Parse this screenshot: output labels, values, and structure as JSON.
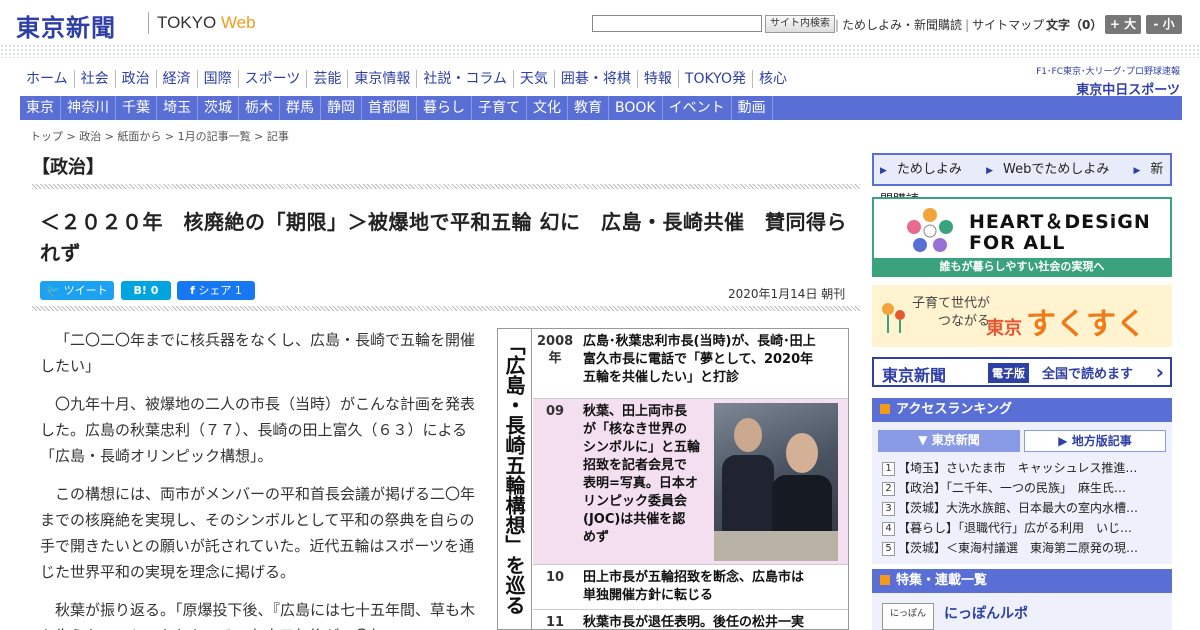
{
  "header": {
    "logo": "東京新聞",
    "logo_sub_prefix": "TOKYO ",
    "logo_sub_accent": "Web",
    "search_button": "サイト内検索",
    "links": [
      "ためしよみ・新聞購読",
      "サイトマップ"
    ],
    "font_label": "文字（0）",
    "font_bigger": "+ 大",
    "font_smaller": "- 小"
  },
  "main_nav": [
    "ホーム",
    "社会",
    "政治",
    "経済",
    "国際",
    "スポーツ",
    "芸能",
    "東京情報",
    "社説・コラム",
    "天気",
    "囲碁・将棋",
    "特報",
    "TOKYO発",
    "核心"
  ],
  "chunichi": {
    "small": "F1･FC東京･大リーグ･プロ野球速報",
    "big": "東京中日スポーツ"
  },
  "sub_nav": [
    "東京",
    "神奈川",
    "千葉",
    "埼玉",
    "茨城",
    "栃木",
    "群馬",
    "静岡",
    "首都圏",
    "暮らし",
    "子育て",
    "文化",
    "教育",
    "BOOK",
    "イベント",
    "動画"
  ],
  "breadcrumb": [
    "トップ",
    "政治",
    "紙面から",
    "1月の記事一覧",
    "記事"
  ],
  "section": "【政治】",
  "article": {
    "headline": "＜２０２０年　核廃絶の「期限」＞被爆地で平和五輪 幻に　広島・長崎共催　賛同得られず",
    "share": {
      "tweet": "ツイート",
      "hatena": "B! 0",
      "facebook": "シェア 1"
    },
    "date": "2020年1月14日 朝刊",
    "paragraphs": [
      "「二〇二〇年までに核兵器をなくし、広島・長崎で五輪を開催したい」",
      "〇九年十月、被爆地の二人の市長（当時）がこんな計画を発表した。広島の秋葉忠利（７７）、長崎の田上富久（６３）による「広島・長崎オリンピック構想」。",
      "この構想には、両市がメンバーの平和首長会議が掲げる二〇年までの核廃絶を実現し、そのシンボルとして平和の祭典を自らの手で開きたいとの願いが託されていた。近代五輪はスポーツを通じた世界平和の実現を理念に掲げる。",
      "秋葉が振り返る。「原爆投下後、『広島には七十五年間、草も木も生えない』といわれた。その七十五年後が二〇年"
    ]
  },
  "timeline": {
    "title": "「広島・長崎五輪構想」を巡る動き",
    "rows": [
      {
        "year": "2008\n年",
        "text": "広島･秋葉忠利市長(当時)が、長崎･田上\n富久市長に電話で「夢として、2020年\n五輪を共催したい」と打診"
      },
      {
        "year": "09",
        "text": "秋葉、田上両市長\nが「核なき世界の\nシンボルに」と五輪\n招致を記者会見で\n表明=写真。日本オ\nリンピック委員会\n(JOC)は共催を認\nめず"
      },
      {
        "year": "10",
        "text": "田上市長が五輪招致を断念、広島市は\n単独開催方針に転じる"
      },
      {
        "year": "11",
        "text": "秋葉市長が退任表明。後任の松井一実"
      }
    ]
  },
  "sidebar": {
    "trial": [
      "ためしよみ",
      "Webでためしよみ",
      "新聞購読"
    ],
    "heart_line1": "HEART＆DESiGN",
    "heart_line2": "FOR ALL",
    "heart_caption": "誰もが暮らしやすい社会の実現へ",
    "suku_small_1": "子育て世代が",
    "suku_small_2": "つながる",
    "suku_city": "東京",
    "suku_big": "すくすく",
    "edition_logo": "東京新聞",
    "edition_tag": "電子版",
    "edition_text": "全国で読めます",
    "ranking_title": "アクセスランキング",
    "ranking_tabs": [
      "東京新聞",
      "地方版記事"
    ],
    "ranking": [
      {
        "num": "1",
        "text": "【埼玉】さいたま市　キャッシュレス推進…"
      },
      {
        "num": "2",
        "text": "【政治】「二千年、一つの民族」　麻生氏…"
      },
      {
        "num": "3",
        "text": "【茨城】大洗水族館、日本最大の室内水槽…"
      },
      {
        "num": "4",
        "text": "【暮らし】「退職代行」広がる利用　いじ…"
      },
      {
        "num": "5",
        "text": "【茨城】＜東海村議選　東海第二原発の現…"
      }
    ],
    "features_title": "特集・連載一覧",
    "nippon_icon": "にっぽん",
    "nippon_title": "にっぽんルポ"
  },
  "colors": {
    "brand": "#2e3fa6",
    "nav": "#5a6fd6",
    "accent": "#f29a1b",
    "heart": "#3aa37e"
  }
}
